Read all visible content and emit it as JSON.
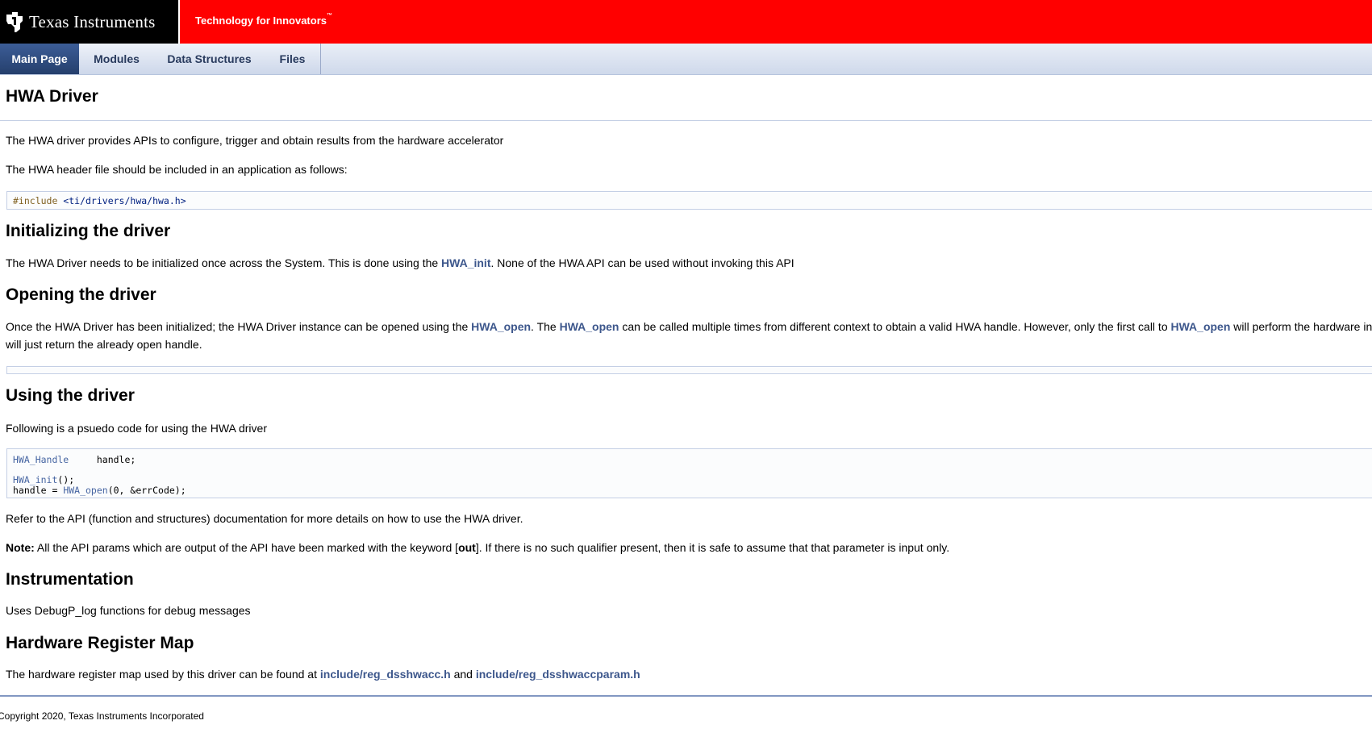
{
  "header": {
    "brand_big": "Texas Instruments",
    "tagline": "Technology for Innovators",
    "tagline_mark": "™",
    "logo_icon": "ti-logo-icon",
    "colors": {
      "banner": "#ff0000",
      "logo_bg": "#000000"
    }
  },
  "nav": {
    "tabs": [
      {
        "label": "Main Page",
        "active": true
      },
      {
        "label": "Modules"
      },
      {
        "label": "Data Structures"
      },
      {
        "label": "Files"
      }
    ]
  },
  "page": {
    "title": "HWA Driver",
    "intro1": "The HWA driver provides APIs to configure, trigger and obtain results from the hardware accelerator",
    "intro2": "The HWA header file should be included in an application as follows:",
    "include_code": {
      "directive": "#include ",
      "path": "<ti/drivers/hwa/hwa.h>"
    },
    "sec_init": {
      "heading": "Initializing the driver",
      "text_a": "The HWA Driver needs to be initialized once across the System. This is done using the ",
      "link": "HWA_init",
      "text_b": ". None of the HWA API can be used without invoking this API"
    },
    "sec_open": {
      "heading": "Opening the driver",
      "t1": "Once the HWA Driver has been initialized; the HWA Driver instance can be opened using the ",
      "l1": "HWA_open",
      "t2": ". The ",
      "l2": "HWA_open",
      "t3": " can be called multiple times from different context to obtain a valid HWA handle. However, only the first call to ",
      "l3": "HWA_open",
      "t4": " will perform the hardware initia",
      "line2": "will just return the already open handle."
    },
    "sec_use": {
      "heading": "Using the driver",
      "text": "Following is a psuedo code for using the HWA driver",
      "code": {
        "l1_type": "HWA_Handle",
        "l1_rest": "     handle;",
        "l2_fn": "HWA_init",
        "l2_rest": "();",
        "l3_a": "handle = ",
        "l3_fn": "HWA_open",
        "l3_rest": "(0, &errCode);"
      },
      "refer": "Refer to the API (function and structures) documentation for more details on how to use the HWA driver.",
      "note_label": "Note:",
      "note_a": " All the API params which are output of the API have been marked with the keyword [",
      "note_kw": "out",
      "note_b": "]. If there is no such qualifier present, then it is safe to assume that that parameter is input only."
    },
    "sec_instr": {
      "heading": "Instrumentation",
      "text": "Uses DebugP_log functions for debug messages"
    },
    "sec_hw": {
      "heading": "Hardware Register Map",
      "text_a": "The hardware register map used by this driver can be found at ",
      "link1": "include/reg_dsshwacc.h",
      "text_b": " and ",
      "link2": "include/reg_dsshwaccparam.h"
    }
  },
  "footer": {
    "copyright": "Copyright 2020, Texas Instruments Incorporated"
  }
}
